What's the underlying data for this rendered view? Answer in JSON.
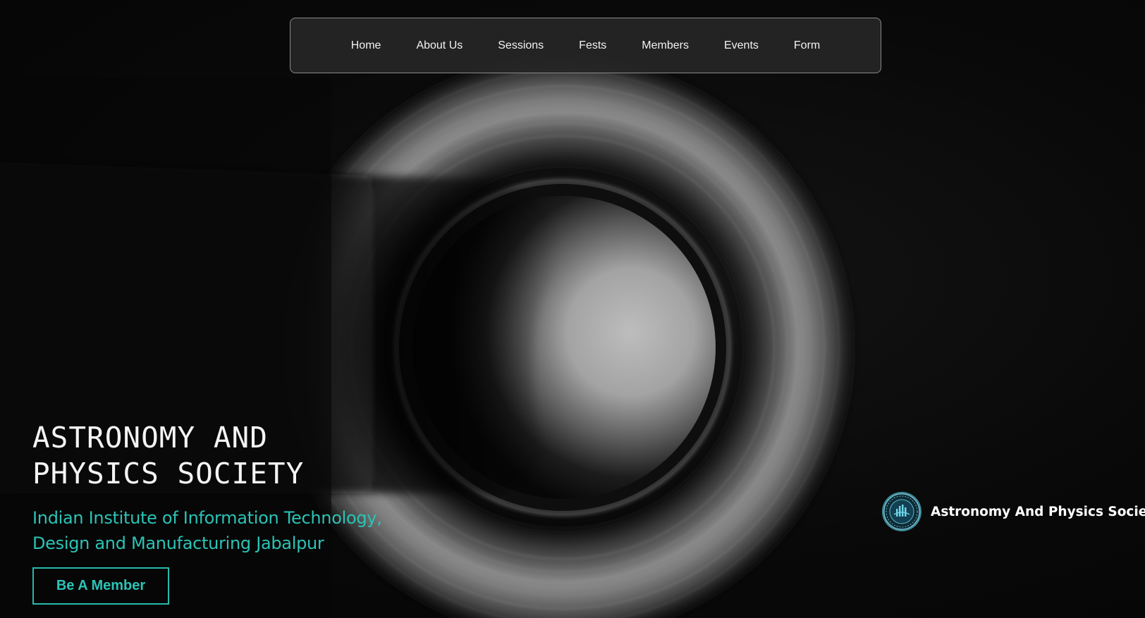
{
  "nav": {
    "items": [
      {
        "label": "Home"
      },
      {
        "label": "About Us"
      },
      {
        "label": "Sessions"
      },
      {
        "label": "Fests"
      },
      {
        "label": "Members"
      },
      {
        "label": "Events"
      },
      {
        "label": "Form"
      }
    ]
  },
  "hero": {
    "title_line1": "ASTRONOMY AND",
    "title_line2": "PHYSICS SOCIETY",
    "subtitle_line1": "Indian Institute of Information Technology,",
    "subtitle_line2": "Design and Manufacturing Jabalpur",
    "cta_label": "Be A Member",
    "image_icon": "saturn-rings-image"
  },
  "brand": {
    "name": "Astronomy And Physics Society",
    "logo_icon": "society-logo-icon"
  },
  "colors": {
    "accent": "#2bc3b6",
    "background": "#070707",
    "nav_background": "#262626",
    "nav_border": "#8a8a8a",
    "text": "#f4f4f4"
  }
}
